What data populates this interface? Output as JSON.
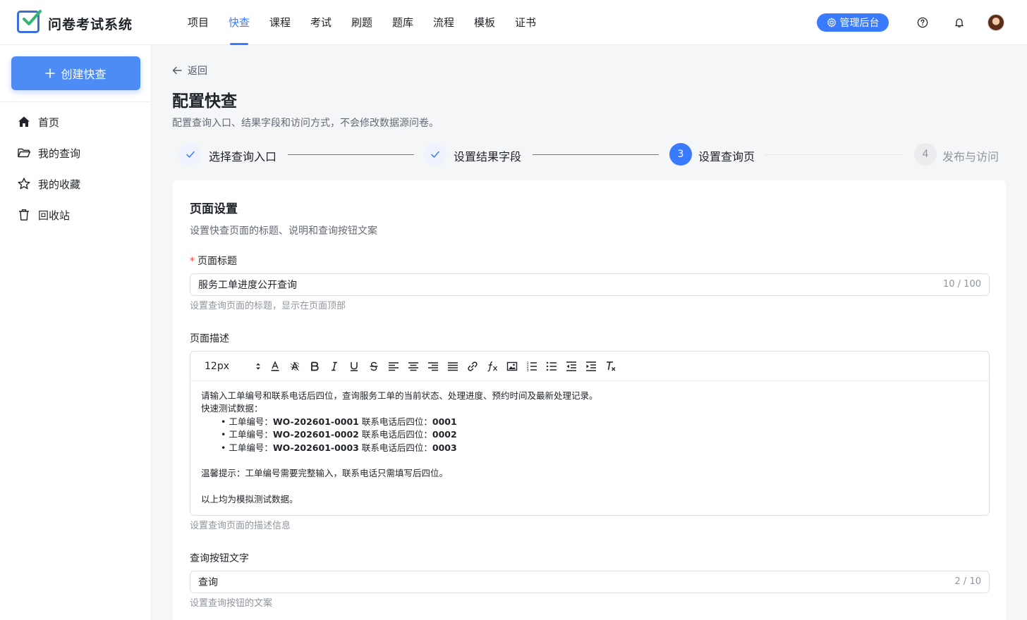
{
  "app": {
    "title": "问卷考试系统"
  },
  "nav": {
    "items": [
      "项目",
      "快查",
      "课程",
      "考试",
      "刷题",
      "题库",
      "流程",
      "模板",
      "证书"
    ],
    "active_index": 1
  },
  "header": {
    "admin_label": "管理后台",
    "icons": [
      "help-icon",
      "bell-icon"
    ]
  },
  "sidebar": {
    "create_label": "创建快查",
    "items": [
      {
        "label": "首页",
        "icon": "home-icon"
      },
      {
        "label": "我的查询",
        "icon": "folder-icon"
      },
      {
        "label": "我的收藏",
        "icon": "star-icon"
      },
      {
        "label": "回收站",
        "icon": "trash-icon"
      }
    ]
  },
  "page": {
    "back_label": "返回",
    "title": "配置快查",
    "subtitle": "配置查询入口、结果字段和访问方式，不会修改数据源问卷。"
  },
  "steps": [
    {
      "label": "选择查询入口",
      "status": "done"
    },
    {
      "label": "设置结果字段",
      "status": "done"
    },
    {
      "number": "3",
      "label": "设置查询页",
      "status": "current"
    },
    {
      "number": "4",
      "label": "发布与访问",
      "status": "todo"
    }
  ],
  "colors": {
    "primary": "#3a7afe",
    "required": "#f54a45",
    "muted": "#8f959e"
  },
  "card": {
    "title": "页面设置",
    "subtitle": "设置快查页面的标题、说明和查询按钮文案",
    "title_field": {
      "label": "页面标题",
      "required": true,
      "value": "服务工单进度公开查询",
      "count": "10 / 100",
      "help": "设置查询页面的标题，显示在页面顶部"
    },
    "desc_field": {
      "label": "页面描述",
      "font_size": "12px",
      "help": "设置查询页面的描述信息",
      "content": {
        "intro": "请输入工单编号和联系电话后四位，查询服务工单的当前状态、处理进度、预约时间及最新处理记录。",
        "test_title": "快速测试数据：",
        "order_label": "工单编号：",
        "phone_label": "联系电话后四位：",
        "rows": [
          {
            "order": "WO-202601-0001",
            "phone": "0001"
          },
          {
            "order": "WO-202601-0002",
            "phone": "0002"
          },
          {
            "order": "WO-202601-0003",
            "phone": "0003"
          }
        ],
        "tip": "温馨提示：工单编号需要完整输入，联系电话只需填写后四位。",
        "note": "以上均为模拟测试数据。"
      }
    },
    "button_field": {
      "label": "查询按钮文字",
      "value": "查询",
      "count": "2 / 10",
      "help": "设置查询按钮的文案"
    }
  }
}
